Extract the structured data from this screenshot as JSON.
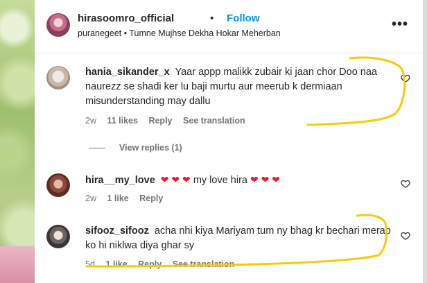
{
  "header": {
    "username": "hirasoomro_official",
    "separator": "•",
    "follow_label": "Follow",
    "audio_text": "puranegeet • Tumne Mujhse Dekha Hokar Meherban",
    "more_icon": "•••"
  },
  "comments": [
    {
      "username": "hania_sikander_x",
      "text": "Yaar appp malikk zubair ki jaan chor Doo naa naurezz se shadi ker lu baji murtu aur meerub k dermiaan misunderstanding may dallu",
      "age": "2w",
      "likes": "11 likes",
      "reply": "Reply",
      "translation": "See translation"
    },
    {
      "username": "hira__my_love",
      "text_mid": "my love hira",
      "age": "2w",
      "likes": "1 like",
      "reply": "Reply"
    },
    {
      "username": "sifooz_sifooz",
      "text": "acha nhi kiya Mariyam tum ny bhag kr bechari merab ko hi niklwa diya ghar sy",
      "age": "5d",
      "likes": "1 like",
      "reply": "Reply",
      "translation": "See translation"
    }
  ],
  "view_replies": "View replies (1)",
  "colors": {
    "accent": "#0095f6",
    "annotation": "#f5cc0a",
    "heart_red": "#ed1c2c"
  }
}
